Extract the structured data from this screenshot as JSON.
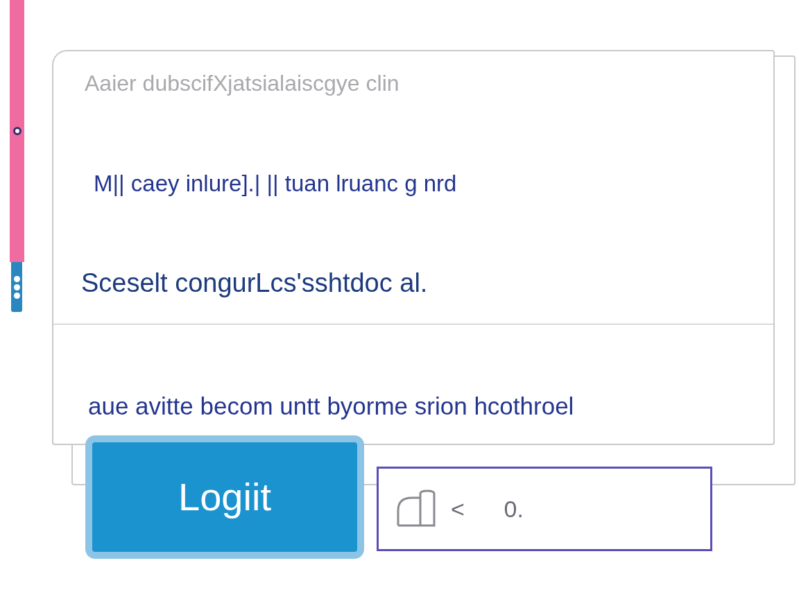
{
  "card": {
    "header": "Aaier dubscifXjatsialaiscgye clin",
    "lines": [
      "M|| caey inlure].| || tuan lruanc g nrd",
      "Sceselt congurLcs'sshtdoc al."
    ],
    "footer": "aue avitte becom untt byorme srion hcothroel"
  },
  "login_button": "Logiit",
  "field": {
    "value": "<      0."
  }
}
